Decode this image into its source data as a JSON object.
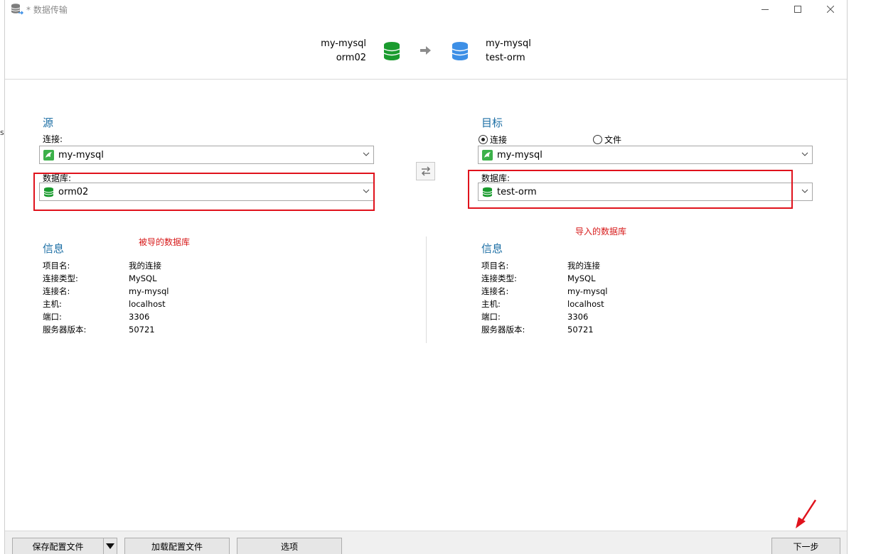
{
  "title": "* 数据传输",
  "summary": {
    "source_connection": "my-mysql",
    "source_database": "orm02",
    "target_connection": "my-mysql",
    "target_database": "test-orm"
  },
  "stray_char": "s",
  "source": {
    "section_title": "源",
    "connection_label": "连接:",
    "connection_value": "my-mysql",
    "database_label": "数据库:",
    "database_value": "orm02",
    "annotation": "被导的数据库",
    "info_title": "信息",
    "info": [
      {
        "key": "项目名:",
        "value": "我的连接"
      },
      {
        "key": "连接类型:",
        "value": "MySQL"
      },
      {
        "key": "连接名:",
        "value": "my-mysql"
      },
      {
        "key": "主机:",
        "value": "localhost"
      },
      {
        "key": "端口:",
        "value": "3306"
      },
      {
        "key": "服务器版本:",
        "value": "50721"
      }
    ]
  },
  "target": {
    "section_title": "目标",
    "radio_connection": "连接",
    "radio_file": "文件",
    "selected": "连接",
    "connection_value": "my-mysql",
    "database_label": "数据库:",
    "database_value": "test-orm",
    "annotation": "导入的数据库",
    "info_title": "信息",
    "info": [
      {
        "key": "项目名:",
        "value": "我的连接"
      },
      {
        "key": "连接类型:",
        "value": "MySQL"
      },
      {
        "key": "连接名:",
        "value": "my-mysql"
      },
      {
        "key": "主机:",
        "value": "localhost"
      },
      {
        "key": "端口:",
        "value": "3306"
      },
      {
        "key": "服务器版本:",
        "value": "50721"
      }
    ]
  },
  "footer": {
    "save_config": "保存配置文件",
    "load_config": "加载配置文件",
    "options": "选项",
    "next": "下一步"
  },
  "colors": {
    "accent_title": "#1d6fa5",
    "annotation_red": "#e0121c",
    "db_green": "#1a9b2e",
    "db_blue": "#3d8fe6"
  }
}
